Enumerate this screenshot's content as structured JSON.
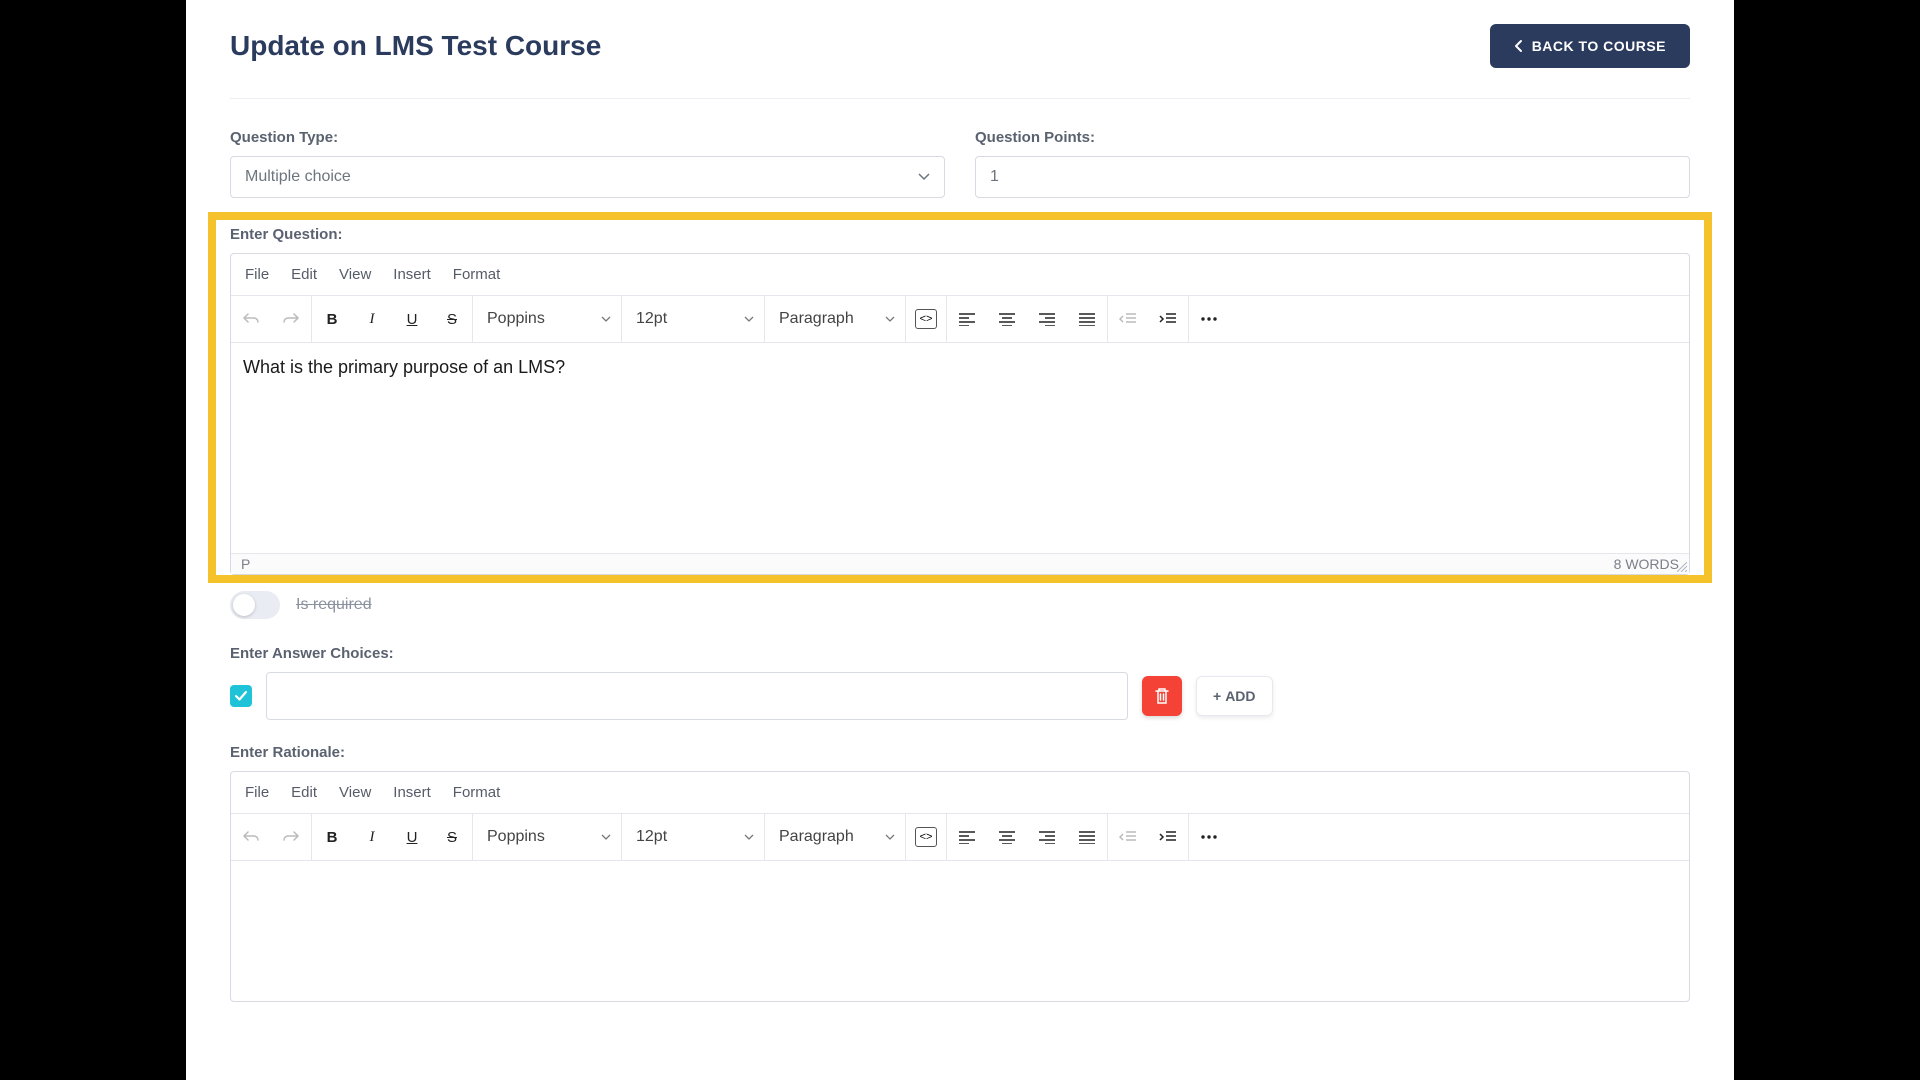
{
  "header": {
    "title": "Update on LMS Test Course",
    "back_label": "BACK TO COURSE"
  },
  "question": {
    "type_label": "Question Type:",
    "type_value": "Multiple choice",
    "points_label": "Question Points:",
    "points_value": "1",
    "enter_label": "Enter Question:",
    "body": "What is the primary purpose of an LMS?",
    "status_path": "P",
    "word_count": "8 WORDS"
  },
  "editor_menu": {
    "file": "File",
    "edit": "Edit",
    "view": "View",
    "insert": "Insert",
    "format": "Format"
  },
  "toolbar": {
    "font": "Poppins",
    "size": "12pt",
    "block": "Paragraph"
  },
  "required": {
    "label": "Is required"
  },
  "answers": {
    "label": "Enter Answer Choices:",
    "add_label": "ADD"
  },
  "rationale": {
    "label": "Enter Rationale:"
  }
}
